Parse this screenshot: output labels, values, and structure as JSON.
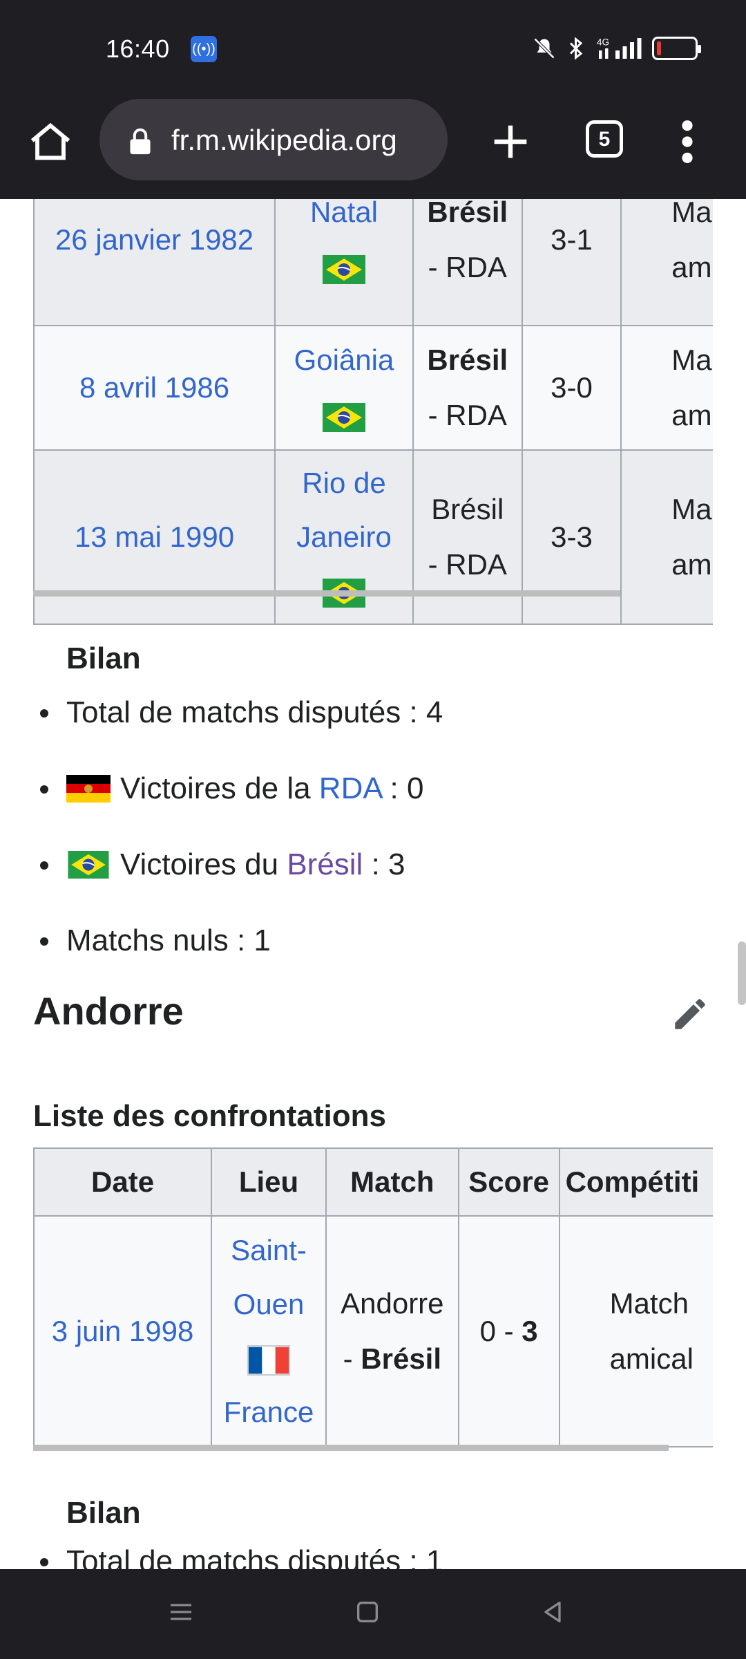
{
  "status_bar": {
    "time": "16:40",
    "icons": [
      "hotspot-icon",
      "mute-icon",
      "bluetooth-icon",
      "signal-4g-icon",
      "battery-low-icon"
    ],
    "network_label": "4G",
    "battery_color": "#e53935"
  },
  "browser": {
    "url": "fr.m.wikipedia.org",
    "tab_count": "5",
    "icons": [
      "home-icon",
      "lock-icon",
      "plus-icon",
      "tabs-icon",
      "more-vert-icon"
    ]
  },
  "table_rda": {
    "rows": [
      {
        "date": "26 janvier 1982",
        "lieu": "Natal",
        "match_winner": "Brésil",
        "match_rest": "- RDA",
        "score": "3-1",
        "competition_top": "Ma",
        "competition_bottom": "am"
      },
      {
        "date": "8 avril 1986",
        "lieu": "Goiânia",
        "match_winner": "Brésil",
        "match_rest": "- RDA",
        "score": "3-0",
        "competition_top": "Ma",
        "competition_bottom": "am"
      },
      {
        "date": "13 mai 1990",
        "lieu_line1": "Rio de",
        "lieu_line2": "Janeiro",
        "match_line1": "Brésil",
        "match_line2": "- RDA",
        "score": "3-3",
        "competition_top": "Ma",
        "competition_bottom": "am"
      }
    ]
  },
  "bilan_rda": {
    "title": "Bilan",
    "total": "Total de matchs disputés : 4",
    "victoires_rda_prefix": "Victoires de la ",
    "victoires_rda_link": "RDA",
    "victoires_rda_suffix": " : 0",
    "victoires_bresil_prefix": "Victoires du ",
    "victoires_bresil_link": "Brésil",
    "victoires_bresil_suffix": " : 3",
    "nuls": "Matchs nuls : 1"
  },
  "section_andorre": {
    "heading": "Andorre",
    "subheading": "Liste des confrontations",
    "headers": {
      "date": "Date",
      "lieu": "Lieu",
      "match": "Match",
      "score": "Score",
      "competition": "Compétiti"
    },
    "row": {
      "date": "3 juin 1998",
      "lieu_line1": "Saint-",
      "lieu_line2": "Ouen",
      "lieu_country": "France",
      "match_line1": "Andorre",
      "match_dash": "- ",
      "match_winner": "Brésil",
      "score_prefix": "0 - ",
      "score_bold": "3",
      "competition_line1": "Match",
      "competition_line2": "amical"
    },
    "bilan_title": "Bilan",
    "bilan_total_partial": "Total de matchs disputés : 1"
  },
  "colors": {
    "link": "#3366cc",
    "visited_link": "#6b4ba1",
    "chrome_bg": "#1f1e22"
  }
}
